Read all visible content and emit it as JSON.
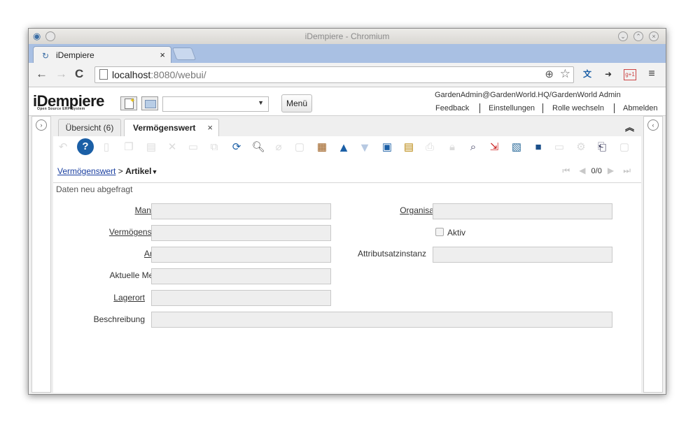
{
  "browser": {
    "window_title": "iDempiere - Chromium",
    "tab_title": "iDempiere",
    "tab_close": "×",
    "url_host": "localhost",
    "url_rest": ":8080/webui/"
  },
  "header": {
    "logo_text": "iDempiere",
    "logo_subtitle": "Open Source  ERP System",
    "menu_button": "Menü",
    "user_context": "GardenAdmin@GardenWorld.HQ/GardenWorld Admin",
    "links": [
      "Feedback",
      "Einstellungen",
      "Rolle wechseln",
      "Abmelden"
    ]
  },
  "window_tabs": {
    "overview": "Übersicht (6)",
    "active": "Vermögenswert",
    "close": "×"
  },
  "breadcrumb": {
    "parent": "Vermögenswert",
    "separator": ">",
    "current": "Artikel"
  },
  "record_nav": {
    "counter": "0/0"
  },
  "status_message": "Daten neu abgefragt",
  "form": {
    "client_label": "Mandant",
    "organization_label": "Organisation",
    "asset_label": "Vermögenswert",
    "active_label": "Aktiv",
    "product_label": "Artikel",
    "attribute_label": "Attributsatzinstanz",
    "quantity_label": "Aktuelle Menge",
    "locator_label": "Lagerort",
    "description_label": "Beschreibung",
    "required_marker": "*"
  },
  "colors": {
    "accent_tab_strip": "#a9c0e3",
    "link_blue": "#1a3fa0",
    "toolbar_blue": "#1b5fa6"
  }
}
